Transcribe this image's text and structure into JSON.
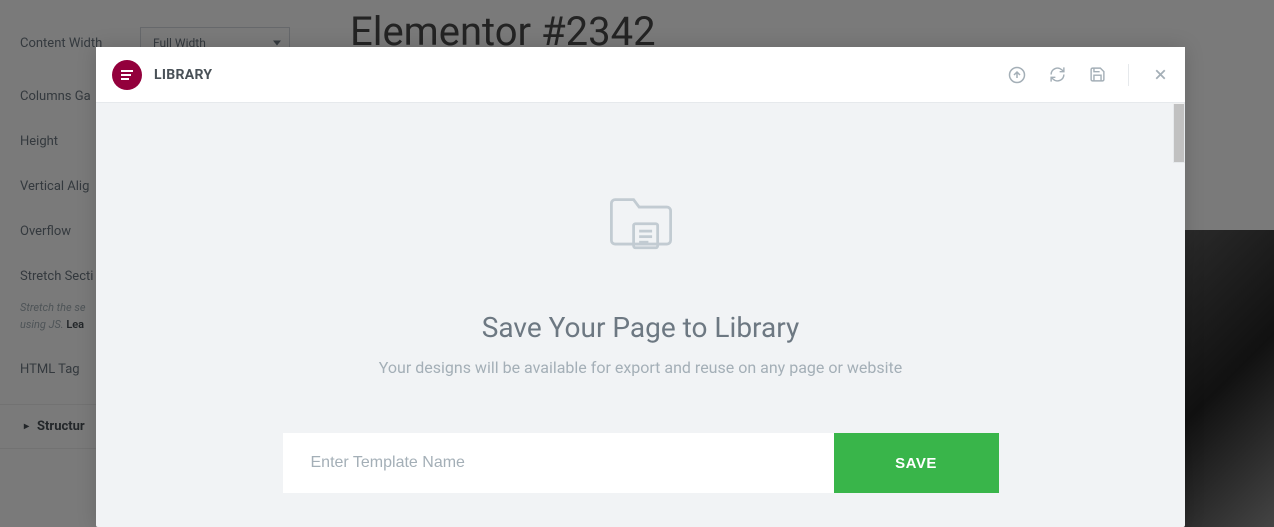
{
  "sidebar": {
    "labels": {
      "content_width": "Content Width",
      "columns_gap": "Columns Ga",
      "height": "Height",
      "vertical_align": "Vertical Alig",
      "overflow": "Overflow",
      "stretch_section": "Stretch Secti",
      "html_tag": "HTML Tag"
    },
    "content_width_value": "Full Width",
    "hint_stretch": "Stretch the se",
    "hint_using": "using JS.",
    "hint_lead": "Lea",
    "accordion": "Structur"
  },
  "page": {
    "title": "Elementor #2342"
  },
  "modal": {
    "title": "LIBRARY",
    "heading": "Save Your Page to Library",
    "subheading": "Your designs will be available for export and reuse on any page or website",
    "input_placeholder": "Enter Template Name",
    "save_label": "SAVE"
  }
}
